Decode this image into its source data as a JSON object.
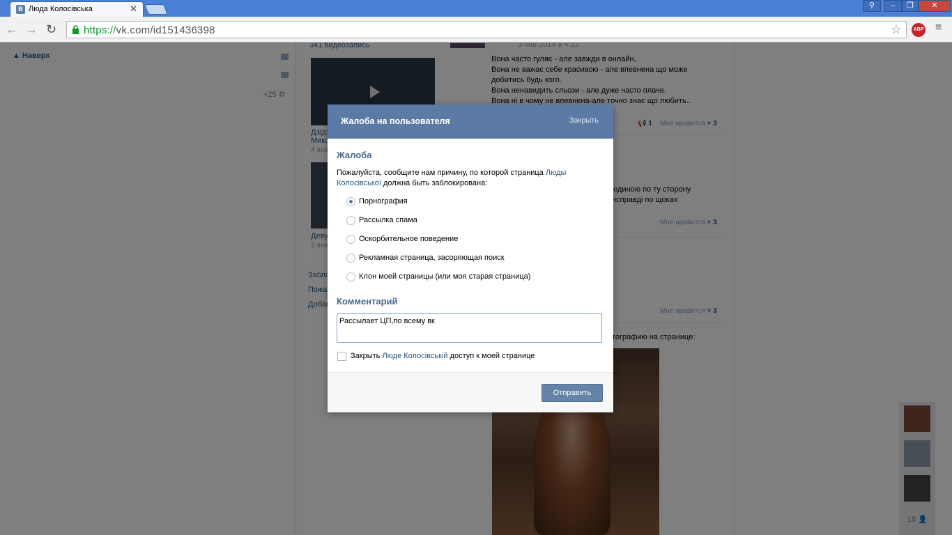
{
  "browser": {
    "tab_title": "Люда Колосівська",
    "tab_favicon": "В",
    "url_scheme": "https://",
    "url_rest": "vk.com/id151436398",
    "abp_label": "ABP"
  },
  "page": {
    "back_to_top": "Наверх",
    "notif_count": "+25",
    "video_count": "341 видеозапись",
    "videos": [
      {
        "caption_1": "Дзідз",
        "caption_2": "Мико",
        "date": "4 янв"
      },
      {
        "caption_1": "Деву",
        "date": "3 янв"
      }
    ],
    "links": [
      "Забло",
      "Пожа",
      "Добав"
    ],
    "post_date": "3 янв 2014 в 4:12",
    "post_lines": [
      "Вона часто гуляє - але завжди в онлайн,",
      "Вона не важає себе красивою - але впевнена що може",
      "добитись будь кого.",
      "Вона ненавидить сльози - але дуже часто плаче.",
      "Вона ні в чому не впевнена-але точно знає що любить.."
    ],
    "reposts": "1",
    "like_label": "Мне нравится",
    "likes": "3",
    "post2_lines": [
      "юдиною по ту сторону",
      "нсправді по щоках"
    ],
    "photo_line": "тографию на странице:",
    "friends_count": "18"
  },
  "modal": {
    "title": "Жалоба на пользователя",
    "close_label": "Закрыть",
    "section_complaint": "Жалоба",
    "desc_before": "Пожалуйста, сообщите нам причину, по которой страница ",
    "desc_link": "Люды Колосівської",
    "desc_after": " должна быть заблокирована:",
    "options": [
      "Порнография",
      "Рассылка спама",
      "Оскорбительное поведение",
      "Рекламная страница, засоряющая поиск",
      "Клон моей страницы (или моя старая страница)"
    ],
    "selected_index": 0,
    "section_comment": "Комментарий",
    "comment_value": "Рассылает ЦП,по всему вк",
    "checkbox_before": "Закрыть ",
    "checkbox_link": "Люде Колосівській",
    "checkbox_after": " доступ к моей странице",
    "submit_label": "Отправить"
  },
  "colors": {
    "vk_blue": "#5b7ba6",
    "link": "#2b587a",
    "heading": "#45688e"
  }
}
